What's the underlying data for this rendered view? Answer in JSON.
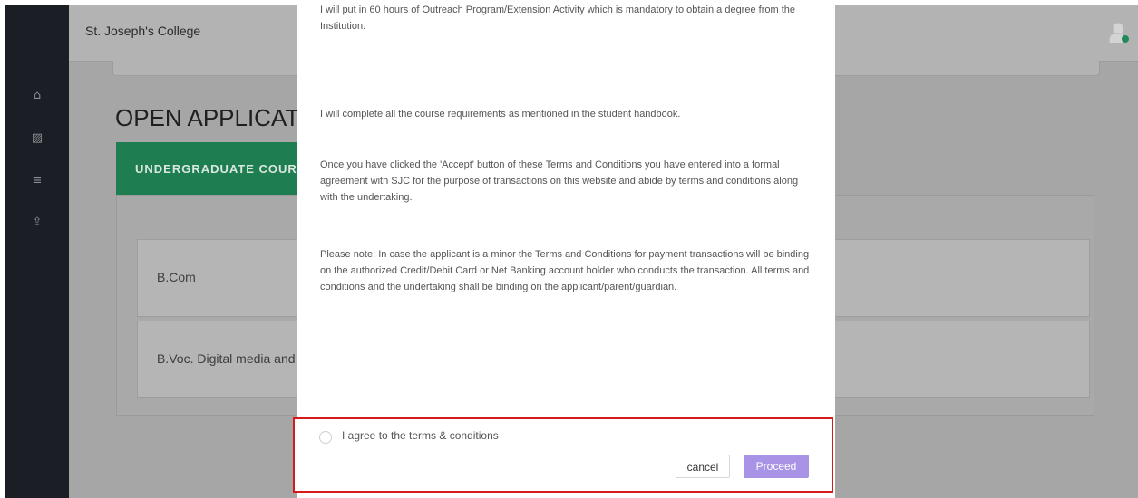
{
  "app": {
    "brand": "St. Joseph's College"
  },
  "sidebar": {
    "items": [
      {
        "name": "home",
        "icon": "home-icon",
        "glyph": "⌂"
      },
      {
        "name": "image",
        "icon": "image-icon",
        "glyph": "▨"
      },
      {
        "name": "menu",
        "icon": "menu-icon",
        "glyph": "≡"
      },
      {
        "name": "upload",
        "icon": "upload-icon",
        "glyph": "⇪"
      }
    ]
  },
  "page": {
    "heading": "OPEN APPLICATIONS",
    "tab_label": "UNDERGRADUATE COURSES",
    "courses": [
      "B.Com",
      "B.Voc. Digital media and animation"
    ]
  },
  "modal": {
    "paragraphs": [
      "I will put in 60 hours of Outreach Program/Extension Activity which is mandatory to obtain a degree from the Institution.",
      "I will complete all the course requirements as mentioned in the student handbook.",
      "Once you have clicked the 'Accept' button of these Terms and Conditions you have entered into a formal agreement with SJC for the purpose of transactions on this website and abide by terms and conditions along with the undertaking.",
      "Please note: In case the applicant is a minor the Terms and Conditions for payment transactions will be binding on the authorized Credit/Debit Card or Net Banking account holder who conducts the transaction. All terms and conditions and the undertaking shall be binding on the applicant/parent/guardian."
    ],
    "agree_label": "I agree to the terms & conditions",
    "cancel_label": "cancel",
    "proceed_label": "Proceed"
  },
  "colors": {
    "sidebar": "#1b1e24",
    "tab_green": "#1f7d52",
    "proceed_button": "#a893e6",
    "highlight_border": "#d51a1a",
    "online_status": "#1d8a57"
  }
}
